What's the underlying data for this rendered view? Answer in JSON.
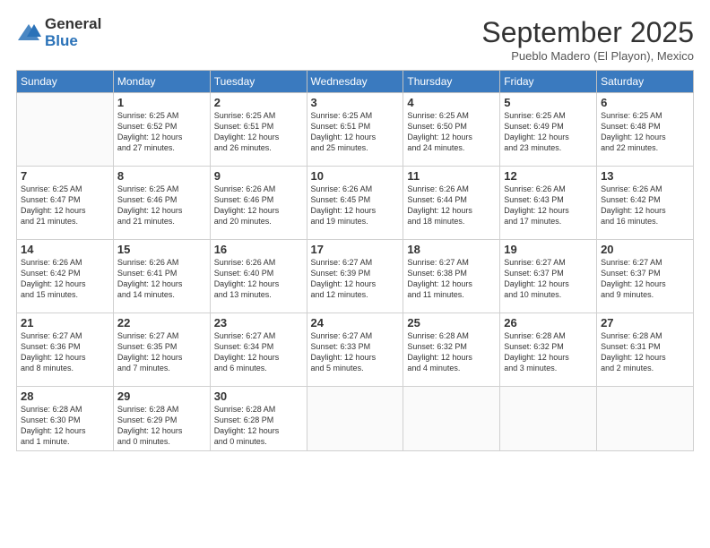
{
  "logo": {
    "general": "General",
    "blue": "Blue"
  },
  "title": "September 2025",
  "location": "Pueblo Madero (El Playon), Mexico",
  "weekdays": [
    "Sunday",
    "Monday",
    "Tuesday",
    "Wednesday",
    "Thursday",
    "Friday",
    "Saturday"
  ],
  "weeks": [
    [
      {
        "day": "",
        "info": ""
      },
      {
        "day": "1",
        "info": "Sunrise: 6:25 AM\nSunset: 6:52 PM\nDaylight: 12 hours\nand 27 minutes."
      },
      {
        "day": "2",
        "info": "Sunrise: 6:25 AM\nSunset: 6:51 PM\nDaylight: 12 hours\nand 26 minutes."
      },
      {
        "day": "3",
        "info": "Sunrise: 6:25 AM\nSunset: 6:51 PM\nDaylight: 12 hours\nand 25 minutes."
      },
      {
        "day": "4",
        "info": "Sunrise: 6:25 AM\nSunset: 6:50 PM\nDaylight: 12 hours\nand 24 minutes."
      },
      {
        "day": "5",
        "info": "Sunrise: 6:25 AM\nSunset: 6:49 PM\nDaylight: 12 hours\nand 23 minutes."
      },
      {
        "day": "6",
        "info": "Sunrise: 6:25 AM\nSunset: 6:48 PM\nDaylight: 12 hours\nand 22 minutes."
      }
    ],
    [
      {
        "day": "7",
        "info": "Sunrise: 6:25 AM\nSunset: 6:47 PM\nDaylight: 12 hours\nand 21 minutes."
      },
      {
        "day": "8",
        "info": "Sunrise: 6:25 AM\nSunset: 6:46 PM\nDaylight: 12 hours\nand 21 minutes."
      },
      {
        "day": "9",
        "info": "Sunrise: 6:26 AM\nSunset: 6:46 PM\nDaylight: 12 hours\nand 20 minutes."
      },
      {
        "day": "10",
        "info": "Sunrise: 6:26 AM\nSunset: 6:45 PM\nDaylight: 12 hours\nand 19 minutes."
      },
      {
        "day": "11",
        "info": "Sunrise: 6:26 AM\nSunset: 6:44 PM\nDaylight: 12 hours\nand 18 minutes."
      },
      {
        "day": "12",
        "info": "Sunrise: 6:26 AM\nSunset: 6:43 PM\nDaylight: 12 hours\nand 17 minutes."
      },
      {
        "day": "13",
        "info": "Sunrise: 6:26 AM\nSunset: 6:42 PM\nDaylight: 12 hours\nand 16 minutes."
      }
    ],
    [
      {
        "day": "14",
        "info": "Sunrise: 6:26 AM\nSunset: 6:42 PM\nDaylight: 12 hours\nand 15 minutes."
      },
      {
        "day": "15",
        "info": "Sunrise: 6:26 AM\nSunset: 6:41 PM\nDaylight: 12 hours\nand 14 minutes."
      },
      {
        "day": "16",
        "info": "Sunrise: 6:26 AM\nSunset: 6:40 PM\nDaylight: 12 hours\nand 13 minutes."
      },
      {
        "day": "17",
        "info": "Sunrise: 6:27 AM\nSunset: 6:39 PM\nDaylight: 12 hours\nand 12 minutes."
      },
      {
        "day": "18",
        "info": "Sunrise: 6:27 AM\nSunset: 6:38 PM\nDaylight: 12 hours\nand 11 minutes."
      },
      {
        "day": "19",
        "info": "Sunrise: 6:27 AM\nSunset: 6:37 PM\nDaylight: 12 hours\nand 10 minutes."
      },
      {
        "day": "20",
        "info": "Sunrise: 6:27 AM\nSunset: 6:37 PM\nDaylight: 12 hours\nand 9 minutes."
      }
    ],
    [
      {
        "day": "21",
        "info": "Sunrise: 6:27 AM\nSunset: 6:36 PM\nDaylight: 12 hours\nand 8 minutes."
      },
      {
        "day": "22",
        "info": "Sunrise: 6:27 AM\nSunset: 6:35 PM\nDaylight: 12 hours\nand 7 minutes."
      },
      {
        "day": "23",
        "info": "Sunrise: 6:27 AM\nSunset: 6:34 PM\nDaylight: 12 hours\nand 6 minutes."
      },
      {
        "day": "24",
        "info": "Sunrise: 6:27 AM\nSunset: 6:33 PM\nDaylight: 12 hours\nand 5 minutes."
      },
      {
        "day": "25",
        "info": "Sunrise: 6:28 AM\nSunset: 6:32 PM\nDaylight: 12 hours\nand 4 minutes."
      },
      {
        "day": "26",
        "info": "Sunrise: 6:28 AM\nSunset: 6:32 PM\nDaylight: 12 hours\nand 3 minutes."
      },
      {
        "day": "27",
        "info": "Sunrise: 6:28 AM\nSunset: 6:31 PM\nDaylight: 12 hours\nand 2 minutes."
      }
    ],
    [
      {
        "day": "28",
        "info": "Sunrise: 6:28 AM\nSunset: 6:30 PM\nDaylight: 12 hours\nand 1 minute."
      },
      {
        "day": "29",
        "info": "Sunrise: 6:28 AM\nSunset: 6:29 PM\nDaylight: 12 hours\nand 0 minutes."
      },
      {
        "day": "30",
        "info": "Sunrise: 6:28 AM\nSunset: 6:28 PM\nDaylight: 12 hours\nand 0 minutes."
      },
      {
        "day": "",
        "info": ""
      },
      {
        "day": "",
        "info": ""
      },
      {
        "day": "",
        "info": ""
      },
      {
        "day": "",
        "info": ""
      }
    ]
  ]
}
